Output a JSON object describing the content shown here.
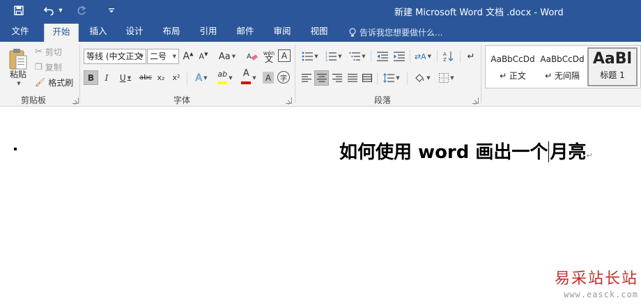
{
  "window": {
    "title": "新建 Microsoft Word 文档 .docx - Word",
    "accent": "#2b579a"
  },
  "qat": {
    "save_icon": "save-icon",
    "undo_icon": "undo-icon",
    "redo_icon": "redo-icon",
    "customize_icon": "customize-icon"
  },
  "tabs": [
    {
      "label": "文件"
    },
    {
      "label": "开始"
    },
    {
      "label": "插入"
    },
    {
      "label": "设计"
    },
    {
      "label": "布局"
    },
    {
      "label": "引用"
    },
    {
      "label": "邮件"
    },
    {
      "label": "审阅"
    },
    {
      "label": "视图"
    }
  ],
  "active_tab": "开始",
  "tell_me": {
    "placeholder": "告诉我您想要做什么..."
  },
  "clipboard": {
    "group_label": "剪贴板",
    "paste": "粘贴",
    "cut": "剪切",
    "copy": "复制",
    "format_painter": "格式刷"
  },
  "font": {
    "group_label": "字体",
    "font_name": "等线 (中文正文",
    "font_size": "二号",
    "change_case": "Aa",
    "bold": "B",
    "italic": "I",
    "underline": "U",
    "strikethrough": "abc",
    "subscript": "x₂",
    "superscript": "x²",
    "phonetic": "wén",
    "text_effects": "A",
    "highlight": "ab",
    "font_color": "A",
    "char_shading": "A",
    "enclose": "字",
    "highlight_color": "#ffff00",
    "font_color_value": "#e00000"
  },
  "paragraph": {
    "group_label": "段落"
  },
  "styles": {
    "items": [
      {
        "sample": "AaBbCcDd",
        "name": "↵ 正文"
      },
      {
        "sample": "AaBbCcDd",
        "name": "↵ 无间隔"
      },
      {
        "sample": "AaBl",
        "name": "标题 1"
      }
    ]
  },
  "document": {
    "heading_before_cursor": "如何使用 word 画出一个",
    "heading_after_cursor": "月亮",
    "paragraph_mark": "↵"
  },
  "watermark": {
    "text": "易采站长站",
    "url": "www.easck.com"
  }
}
